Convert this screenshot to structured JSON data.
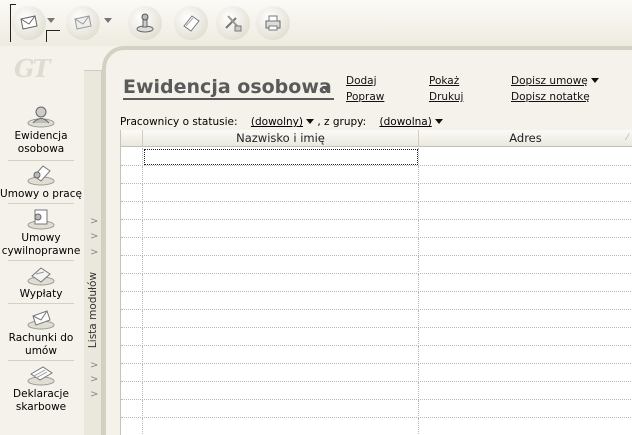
{
  "toolbar": {
    "buttons": [
      {
        "name": "mail-back-icon"
      },
      {
        "name": "mail-forward-icon"
      },
      {
        "name": "stamp-icon"
      },
      {
        "name": "document-icon"
      },
      {
        "name": "tools-icon"
      },
      {
        "name": "printer-icon"
      }
    ]
  },
  "logo": {
    "text": "GT"
  },
  "sidebar": {
    "modules": [
      {
        "label": "Ewidencja osobowa",
        "icon": "person-icon"
      },
      {
        "label": "Umowy o pracę",
        "icon": "contract-icon"
      },
      {
        "label": "Umowy cywilnoprawne",
        "icon": "contract-civil-icon"
      },
      {
        "label": "Wypłaty",
        "icon": "payout-icon"
      },
      {
        "label": "Rachunki do umów",
        "icon": "bill-icon"
      },
      {
        "label": "Deklaracje skarbowe",
        "icon": "declaration-icon"
      }
    ],
    "strip_label": "Lista modułów"
  },
  "header": {
    "title": "Ewidencja osobowa",
    "actions": {
      "dodaj": "Dodaj",
      "popraw": "Popraw",
      "pokaz": "Pokaż",
      "drukuj": "Drukuj",
      "dopisz_umowe": "Dopisz umowę",
      "dopisz_notatke": "Dopisz notatkę"
    }
  },
  "filter": {
    "status_label": "Pracownicy o statusie:",
    "status_value": "(dowolny)",
    "group_label": ", z grupy:",
    "group_value": "(dowolna)"
  },
  "grid": {
    "columns": [
      "",
      "Nazwisko i imię",
      "Adres"
    ],
    "rows": 16
  },
  "colors": {
    "background": "#f4f2ea",
    "title": "#5a5a5a",
    "frame": "#d4d0c3"
  }
}
